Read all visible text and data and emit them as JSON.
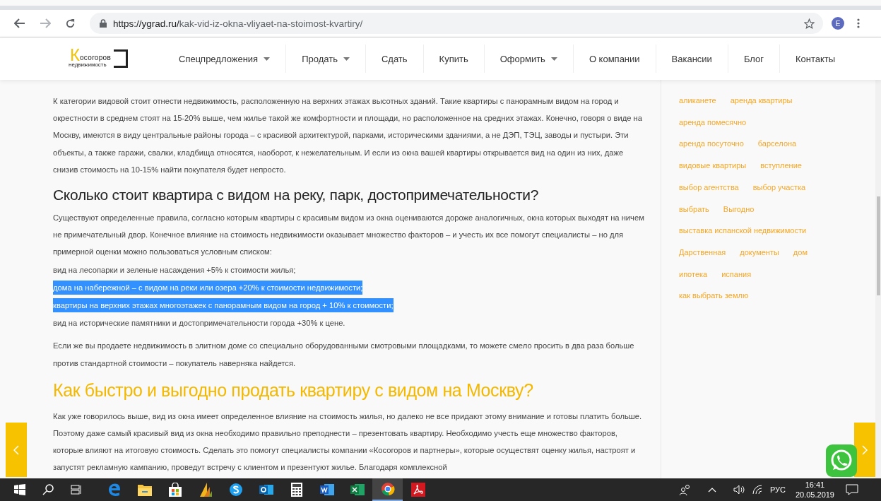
{
  "browser": {
    "url_host": "https://ygrad.ru/",
    "url_path": "kak-vid-iz-okna-vliyaet-na-stoimost-kvartiry/",
    "profile_initial": "E"
  },
  "site_nav": {
    "logo_letter": "К",
    "logo_word": "осогоров",
    "logo_sub": "недвижимость",
    "items": [
      {
        "label": "Спецпредложения",
        "has_dropdown": true
      },
      {
        "label": "Продать",
        "has_dropdown": true
      },
      {
        "label": "Сдать",
        "has_dropdown": false
      },
      {
        "label": "Купить",
        "has_dropdown": false
      },
      {
        "label": "Оформить",
        "has_dropdown": true
      },
      {
        "label": "О компании",
        "has_dropdown": false
      },
      {
        "label": "Вакансии",
        "has_dropdown": false
      },
      {
        "label": "Блог",
        "has_dropdown": false
      },
      {
        "label": "Контакты",
        "has_dropdown": false
      }
    ]
  },
  "article": {
    "blocks": [
      {
        "kind": "paragraph",
        "text": "К категории видовой стоит отнести недвижимость, расположенную на верхних этажах высотных зданий. Такие квартиры с панорамным видом на город и окрестности в среднем стоят на 15-20% выше, чем жилье такой же комфортности и площади, но расположенное на средних этажах. Конечно, говоря о виде на Москву, имеются в виду центральные районы города – с красивой архитектурой, парками, историческими зданиями, а не ДЭП, ТЭЦ, заводы и пустыри. Эти объекты, а также гаражи, свалки, кладбища относятся, наоборот, к нежелательным. И если из окна вашей квартиры открывается вид на один из них, даже снизив стоимость на 10-15% найти покупателя будет непросто."
      },
      {
        "kind": "heading",
        "text": "Сколько стоит квартира с видом на реку, парк, достопримечательности?"
      },
      {
        "kind": "paragraph",
        "text": "Существуют определенные правила, согласно которым квартиры с красивым видом из окна оцениваются дороже аналогичных, окна которых выходят на ничем не примечательный двор. Конечное влияние на стоимость недвижимости оказывает множество факторов – и учесть их все помогут специалисты – но для примерной оценки можно пользоваться условным списком:"
      },
      {
        "kind": "line",
        "text": "вид на лесопарки и зеленые насаждения +5% к стоимости жилья;",
        "highlighted": false
      },
      {
        "kind": "line",
        "text": "дома на набережной – с видом на реки или озера +20% к стоимости недвижимости;",
        "highlighted": true
      },
      {
        "kind": "line",
        "text": "квартиры на верхних этажах многоэтажек с панорамным видом на город + 10% к стоимости;",
        "highlighted": true
      },
      {
        "kind": "line",
        "text": "вид на исторические памятники и достопримечательности города +30% к цене.",
        "highlighted": false
      },
      {
        "kind": "paragraph",
        "text": "Если же вы продаете недвижимость в элитном доме со специально оборудованными смотровыми площадками, то можете смело просить в два раза больше против стандартной стоимости – покупатель наверняка найдется."
      },
      {
        "kind": "accent-heading",
        "text": "Как быстро и выгодно продать квартиру с видом на Москву?"
      },
      {
        "kind": "paragraph",
        "text": "Как уже говорилось выше, вид из окна имеет определенное влияние на стоимость жилья, но далеко не все придают этому внимание и готовы платить больше. Поэтому даже самый красивый вид из окна необходимо правильно преподнести – презентовать квартиру. Необходимо учесть еще множество факторов, которые влияют на итоговую стоимость. Сделать это помогут специалисты компании «Косогоров и партнеры», которые осуществят оценку жилья, настроят и запустят рекламную кампанию, проведут встречу с клиентом и презентуют жилье. Благодаря комплексной"
      }
    ]
  },
  "tags": [
    "аликанете",
    "аренда квартиры",
    "аренда помесячно",
    "аренда посуточно",
    "барселона",
    "видовые квартиры",
    "вступление",
    "выбор агентства",
    "выбор участка",
    "выбрать",
    "Выгодно",
    "выставка испанской недвижимости",
    "Дарственная",
    "документы",
    "дом",
    "ипотека",
    "испания",
    "как выбрать землю"
  ],
  "taskbar": {
    "apps": [
      {
        "kind": "edge",
        "active": false
      },
      {
        "kind": "explorer",
        "active": false
      },
      {
        "kind": "store",
        "active": false
      },
      {
        "kind": "dynamics",
        "active": false
      },
      {
        "kind": "skype",
        "active": false
      },
      {
        "kind": "outlook",
        "active": false
      },
      {
        "kind": "calculator",
        "active": false
      },
      {
        "kind": "word",
        "active": false
      },
      {
        "kind": "excel",
        "active": false
      },
      {
        "kind": "chrome",
        "active": true
      },
      {
        "kind": "acrobat",
        "active": false
      }
    ],
    "language": "РУС",
    "time": "16:41",
    "date": "20.05.2019"
  }
}
